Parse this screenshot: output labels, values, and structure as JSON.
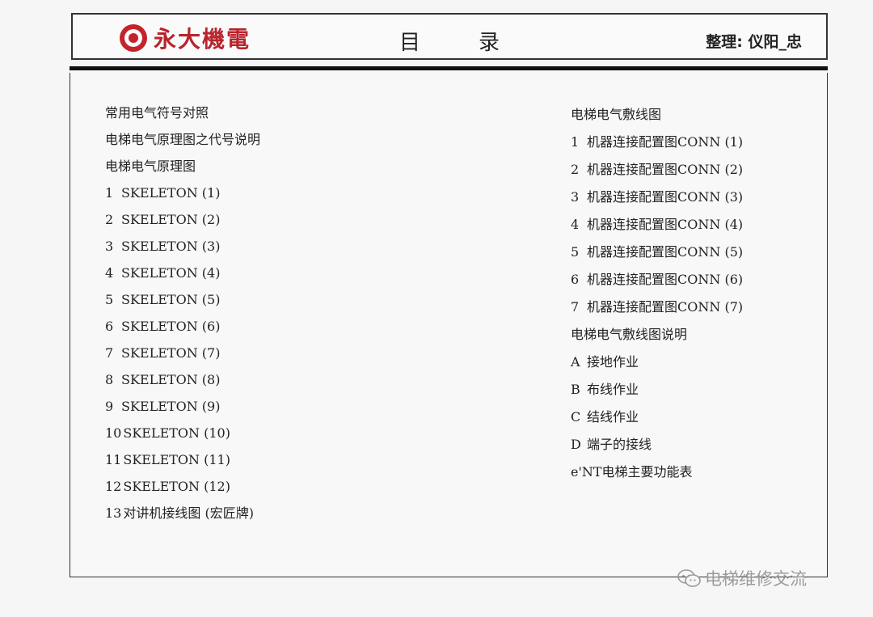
{
  "header": {
    "logo_text": "永大機電",
    "title": "目录",
    "title_left": "目",
    "title_right": "录",
    "compiler": "整理: 仪阳_忠"
  },
  "left_column": [
    {
      "num": "",
      "label": "常用电气符号对照"
    },
    {
      "num": "",
      "label": "电梯电气原理图之代号说明"
    },
    {
      "num": "",
      "label": "电梯电气原理图"
    },
    {
      "num": "1",
      "label": "SKELETON (1)"
    },
    {
      "num": "2",
      "label": "SKELETON (2)"
    },
    {
      "num": "3",
      "label": "SKELETON (3)"
    },
    {
      "num": "4",
      "label": "SKELETON (4)"
    },
    {
      "num": "5",
      "label": "SKELETON (5)"
    },
    {
      "num": "6",
      "label": "SKELETON (6)"
    },
    {
      "num": "7",
      "label": "SKELETON (7)"
    },
    {
      "num": "8",
      "label": "SKELETON (8)"
    },
    {
      "num": "9",
      "label": "SKELETON (9)"
    },
    {
      "num": "10",
      "label": "SKELETON (10)"
    },
    {
      "num": "11",
      "label": "SKELETON (11)"
    },
    {
      "num": "12",
      "label": "SKELETON (12)"
    },
    {
      "num": "13",
      "label": "对讲机接线图 (宏匠牌)"
    }
  ],
  "right_column": [
    {
      "num": "",
      "label": "电梯电气敷线图"
    },
    {
      "num": "1",
      "label": "机器连接配置图CONN (1)"
    },
    {
      "num": "2",
      "label": "机器连接配置图CONN (2)"
    },
    {
      "num": "3",
      "label": "机器连接配置图CONN (3)"
    },
    {
      "num": "4",
      "label": "机器连接配置图CONN (4)"
    },
    {
      "num": "5",
      "label": "机器连接配置图CONN (5)"
    },
    {
      "num": "6",
      "label": "机器连接配置图CONN (6)"
    },
    {
      "num": "7",
      "label": "机器连接配置图CONN (7)"
    },
    {
      "num": "",
      "label": "电梯电气敷线图说明"
    },
    {
      "num": "A",
      "label": "接地作业"
    },
    {
      "num": "B",
      "label": "布线作业"
    },
    {
      "num": "C",
      "label": "结线作业"
    },
    {
      "num": "D",
      "label": "端子的接线"
    },
    {
      "num": "",
      "label": "e'NT电梯主要功能表"
    }
  ],
  "watermark": {
    "text": "电梯维修交流",
    "icon": "wechat-icon"
  },
  "colors": {
    "logo_red": "#c4232b",
    "frame": "#333333"
  }
}
